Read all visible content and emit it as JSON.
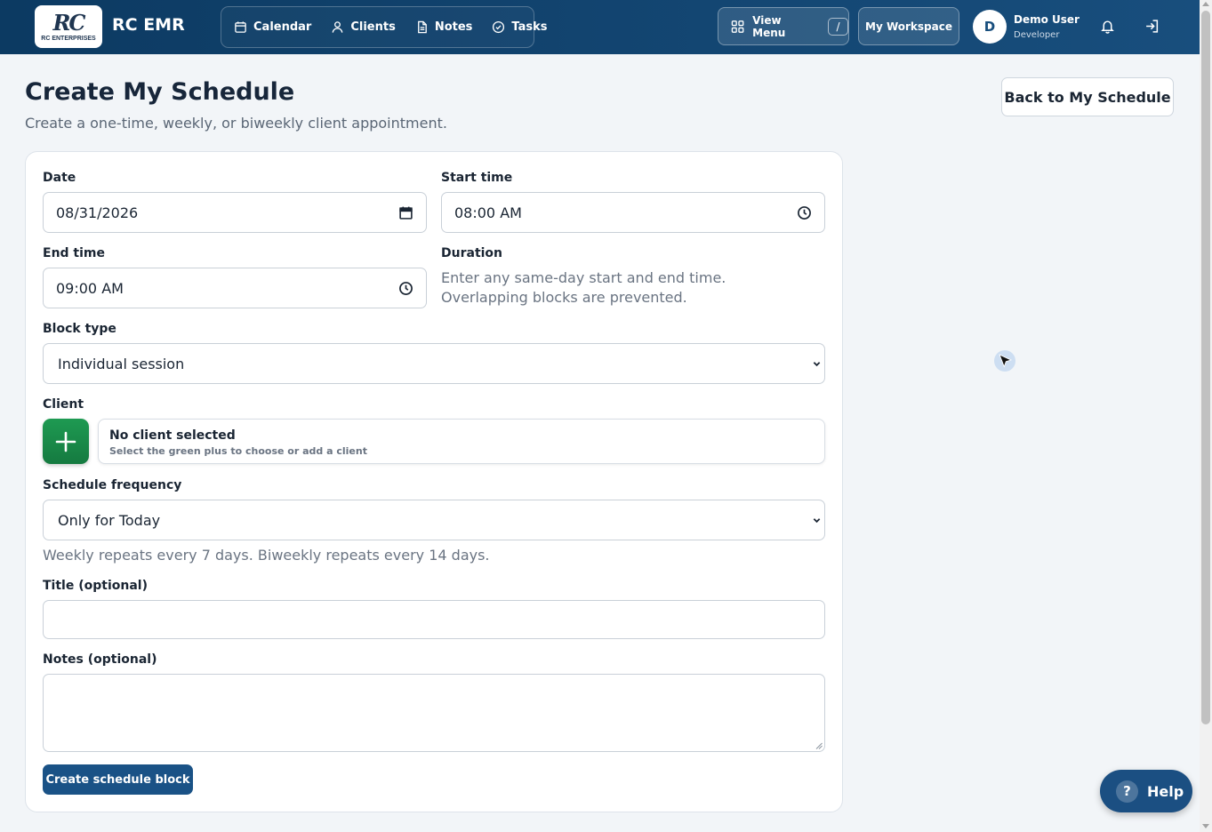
{
  "header": {
    "logo_text": "RC",
    "logo_sub": "RC ENTERPRISES",
    "app_title": "RC EMR",
    "nav": [
      {
        "label": "Calendar",
        "icon": "calendar-icon"
      },
      {
        "label": "Clients",
        "icon": "user-icon"
      },
      {
        "label": "Notes",
        "icon": "document-icon"
      },
      {
        "label": "Tasks",
        "icon": "check-circle-icon"
      }
    ],
    "view_menu_label": "View Menu",
    "view_menu_shortcut": "/",
    "workspace_label": "My Workspace",
    "user_initial": "D",
    "user_name": "Demo User",
    "user_role": "Developer"
  },
  "page": {
    "title": "Create My Schedule",
    "subtitle": "Create a one-time, weekly, or biweekly client appointment.",
    "back_button": "Back to My Schedule"
  },
  "form": {
    "date_label": "Date",
    "date_value": "08/31/2026",
    "start_label": "Start time",
    "start_value": "08:00 AM",
    "end_label": "End time",
    "end_value": "09:00 AM",
    "duration_label": "Duration",
    "duration_hint": "Enter any same-day start and end time. Overlapping blocks are prevented.",
    "block_type_label": "Block type",
    "block_type_value": "Individual session",
    "client_label": "Client",
    "client_title": "No client selected",
    "client_sub": "Select the green plus to choose or add a client",
    "frequency_label": "Schedule frequency",
    "frequency_value": "Only for Today",
    "frequency_hint": "Weekly repeats every 7 days. Biweekly repeats every 14 days.",
    "title_label": "Title (optional)",
    "title_value": "",
    "notes_label": "Notes (optional)",
    "notes_value": "",
    "submit_label": "Create schedule block"
  },
  "help": {
    "label": "Help",
    "icon_text": "?"
  },
  "colors": {
    "header": "#0c3a62",
    "primary": "#1a5286",
    "accent_green": "#1e9a52"
  }
}
